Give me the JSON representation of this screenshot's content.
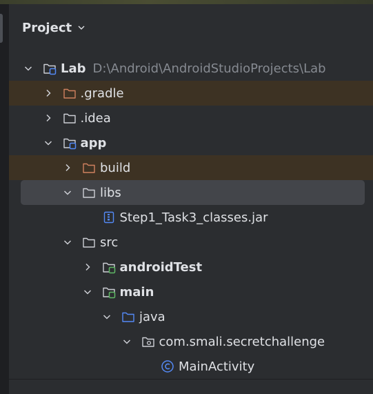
{
  "panel": {
    "title": "Project"
  },
  "tree": [
    {
      "label": "Lab",
      "path": "D:\\Android\\AndroidStudioProjects\\Lab",
      "bold": true,
      "depth": 0,
      "expanded": true,
      "icon": "module-folder-icon",
      "excluded": false
    },
    {
      "label": ".gradle",
      "depth": 1,
      "expanded": false,
      "icon": "excluded-folder-icon",
      "excluded": true
    },
    {
      "label": ".idea",
      "depth": 1,
      "expanded": false,
      "icon": "folder-icon",
      "excluded": false
    },
    {
      "label": "app",
      "bold": true,
      "depth": 1,
      "expanded": true,
      "icon": "module-folder-icon",
      "excluded": false
    },
    {
      "label": "build",
      "depth": 2,
      "expanded": false,
      "icon": "excluded-folder-icon",
      "excluded": true
    },
    {
      "label": "libs",
      "depth": 2,
      "expanded": true,
      "icon": "folder-icon",
      "excluded": false,
      "selected": true
    },
    {
      "label": "Step1_Task3_classes.jar",
      "depth": 3,
      "icon": "jar-file-icon",
      "leaf": true
    },
    {
      "label": "src",
      "depth": 2,
      "expanded": true,
      "icon": "folder-icon"
    },
    {
      "label": "androidTest",
      "bold": true,
      "depth": 3,
      "expanded": false,
      "icon": "source-set-folder-icon"
    },
    {
      "label": "main",
      "bold": true,
      "depth": 3,
      "expanded": true,
      "icon": "source-set-folder-icon"
    },
    {
      "label": "java",
      "depth": 4,
      "expanded": true,
      "icon": "source-root-folder-icon"
    },
    {
      "label": "com.smali.secretchallenge",
      "depth": 5,
      "expanded": true,
      "icon": "package-icon"
    },
    {
      "label": "MainActivity",
      "depth": 6,
      "icon": "class-icon",
      "leaf": true
    }
  ],
  "colors": {
    "background": "#2b2d30",
    "selected_row": "#43454a",
    "excluded_row": "#3d3223",
    "text": "#dfe1e5",
    "path_text": "#868a91",
    "excluded_folder": "#d0815f",
    "module_badge": "#548af7",
    "source_set_badge": "#5fb865",
    "source_root": "#548af7"
  }
}
